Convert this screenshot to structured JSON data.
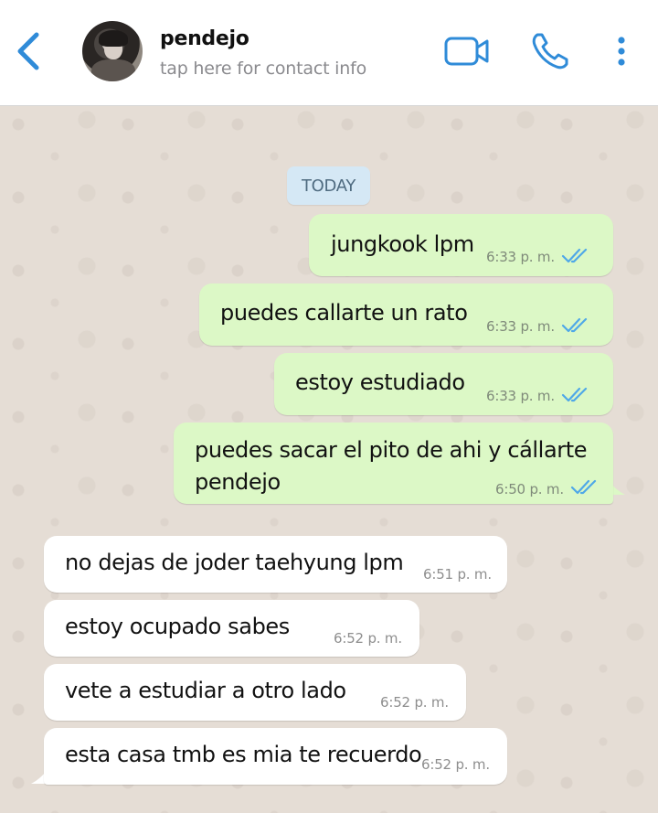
{
  "header": {
    "contact_name": "pendejo",
    "contact_subtitle": "tap here for contact info",
    "accent_color": "#2f8bd8",
    "icons": [
      "chevron-left-icon",
      "video-camera-icon",
      "phone-icon",
      "more-vertical-icon"
    ]
  },
  "chat": {
    "date_label": "TODAY",
    "outgoing_bubble_color": "#dcf8c6",
    "incoming_bubble_color": "#ffffff",
    "read_tick_color": "#4fa8e8",
    "messages": [
      {
        "direction": "outgoing",
        "text": "jungkook lpm",
        "time": "6:33 p. m.",
        "status": "read"
      },
      {
        "direction": "outgoing",
        "text": "puedes callarte un rato",
        "time": "6:33 p. m.",
        "status": "read"
      },
      {
        "direction": "outgoing",
        "text": "estoy estudiado",
        "time": "6:33 p. m.",
        "status": "read"
      },
      {
        "direction": "outgoing",
        "text_line1": "puedes sacar el pito de ahi y cállarte",
        "text_line2": "pendejo",
        "time": "6:50 p. m.",
        "status": "read"
      },
      {
        "direction": "incoming",
        "text": "no dejas de joder taehyung lpm",
        "time": "6:51 p. m."
      },
      {
        "direction": "incoming",
        "text": "estoy ocupado sabes",
        "time": "6:52 p. m."
      },
      {
        "direction": "incoming",
        "text": "vete a estudiar a otro lado",
        "time": "6:52 p. m."
      },
      {
        "direction": "incoming",
        "text": "esta casa tmb es mia te recuerdo",
        "time": "6:52 p. m."
      }
    ]
  }
}
